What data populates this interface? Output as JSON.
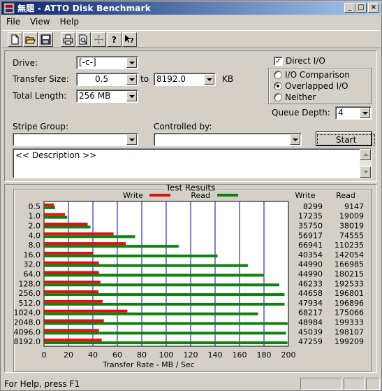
{
  "window": {
    "title": "無題 - ATTO Disk Benchmark",
    "min_label": "_",
    "max_label": "□",
    "close_label": "×"
  },
  "menu": [
    {
      "label": "File",
      "key": "F"
    },
    {
      "label": "View",
      "key": "V"
    },
    {
      "label": "Help",
      "key": "H"
    }
  ],
  "toolbar": {
    "tools": [
      {
        "name": "new-icon"
      },
      {
        "name": "open-icon"
      },
      {
        "name": "save-icon"
      },
      {
        "name": "print-icon"
      },
      {
        "name": "print-preview-icon"
      },
      {
        "name": "move-icon"
      },
      {
        "name": "help-icon"
      },
      {
        "name": "context-help-icon"
      }
    ]
  },
  "settings": {
    "drive_label": "Drive:",
    "drive_value": "[-c-]",
    "transfer_size_label": "Transfer Size:",
    "transfer_from": "0.5",
    "to_label": "to",
    "transfer_to": "8192.0",
    "kb_label": "KB",
    "total_length_label": "Total Length:",
    "total_length_value": "256 MB",
    "direct_io_label": "Direct I/O",
    "direct_io_checked": true,
    "io_comparison_label": "I/O Comparison",
    "overlapped_io_label": "Overlapped I/O",
    "neither_label": "Neither",
    "selected_mode": "overlapped",
    "queue_depth_label": "Queue Depth:",
    "queue_depth_value": "4",
    "stripe_group_label": "Stripe Group:",
    "stripe_group_value": "",
    "controlled_by_label": "Controlled by:",
    "controlled_by_value": "",
    "start_label": "Start",
    "description_text": "<< Description >>"
  },
  "chart_data": {
    "type": "bar",
    "title": "Test Results",
    "legend": [
      {
        "label": "Write",
        "color": "#e01010"
      },
      {
        "label": "Read",
        "color": "#108010"
      }
    ],
    "xlabel": "Transfer Rate - MB / Sec",
    "xlim": [
      0,
      200
    ],
    "xticks": [
      0,
      20,
      40,
      60,
      80,
      100,
      120,
      140,
      160,
      180,
      200
    ],
    "categories": [
      "0.5",
      "1.0",
      "2.0",
      "4.0",
      "8.0",
      "16.0",
      "32.0",
      "64.0",
      "128.0",
      "256.0",
      "512.0",
      "1024.0",
      "2048.0",
      "4096.0",
      "8192.0"
    ],
    "series": [
      {
        "name": "Write",
        "color": "#e01010",
        "values": [
          8299,
          17235,
          35750,
          56917,
          66941,
          40354,
          44990,
          44990,
          46233,
          44658,
          47934,
          68217,
          48984,
          45039,
          47259
        ]
      },
      {
        "name": "Read",
        "color": "#108010",
        "values": [
          9147,
          19009,
          38019,
          74555,
          110235,
          142054,
          166985,
          180215,
          192533,
          196801,
          196896,
          175066,
          199333,
          198107,
          199209
        ]
      }
    ],
    "column_headers": {
      "write": "Write",
      "read": "Read"
    },
    "grid": true
  },
  "status": {
    "text": "For Help, press F1"
  }
}
